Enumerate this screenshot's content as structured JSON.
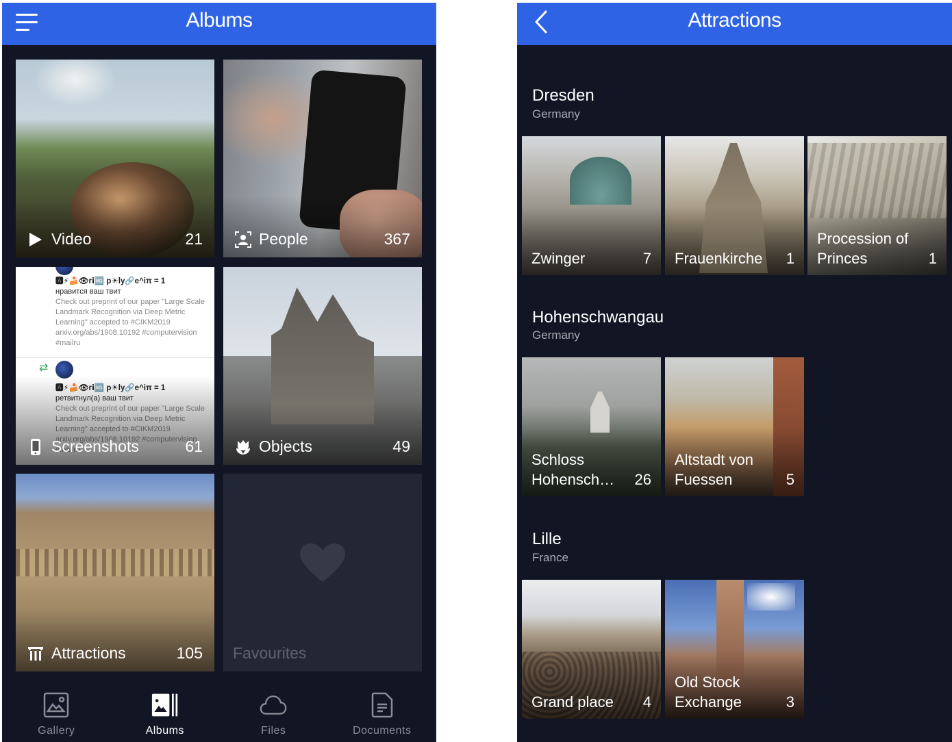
{
  "albums_screen": {
    "header": {
      "title": "Albums",
      "menu_icon": "hamburger-menu-icon"
    },
    "albums": [
      {
        "name": "Video",
        "count": "21",
        "icon": "play-icon"
      },
      {
        "name": "People",
        "count": "367",
        "icon": "face-frame-icon"
      },
      {
        "name": "Screenshots",
        "count": "61",
        "icon": "phone-icon"
      },
      {
        "name": "Objects",
        "count": "49",
        "icon": "flower-icon"
      },
      {
        "name": "Attractions",
        "count": "105",
        "icon": "landmark-icon"
      },
      {
        "name": "Favourites",
        "count": "",
        "icon": "heart-icon"
      }
    ],
    "screenshot_preview": {
      "tweet1": {
        "handle": "🅰⚡🍰👁rⅰ🆖 p☀ly🔗e^iπ = 1",
        "action": "нравится ваш твит",
        "body": "Check out preprint of our paper \"Large Scale Landmark Recognition via Deep Metric Learning\" accepted to #CIKM2019 arxiv.org/abs/1908.10192 #computervision #mailru"
      },
      "tweet2": {
        "handle": "🅰⚡🍰👁rⅰ🆖 p☀ly🔗e^iπ = 1",
        "action": "ретвитнул(а) ваш твит",
        "body": "Check out preprint of our paper \"Large Scale Landmark Recognition via Deep Metric Learning\" accepted to #CIKM2019 arxiv.org/abs/1908.10192 #computervision #mailru"
      }
    },
    "bottom_nav": [
      {
        "label": "Gallery",
        "icon": "gallery-icon",
        "active": false
      },
      {
        "label": "Albums",
        "icon": "albums-icon",
        "active": true
      },
      {
        "label": "Files",
        "icon": "cloud-icon",
        "active": false
      },
      {
        "label": "Documents",
        "icon": "document-icon",
        "active": false
      }
    ]
  },
  "attractions_screen": {
    "header": {
      "title": "Attractions",
      "back_icon": "chevron-left-icon"
    },
    "sections": [
      {
        "city": "Dresden",
        "country": "Germany",
        "items": [
          {
            "name": "Zwinger",
            "count": "7"
          },
          {
            "name": "Frauenkirche",
            "count": "1"
          },
          {
            "name": "Procession of Princes",
            "count": "1"
          }
        ]
      },
      {
        "city": "Hohenschwangau",
        "country": "Germany",
        "items": [
          {
            "name": "Schloss Hohensch…",
            "count": "26"
          },
          {
            "name": "Altstadt von Fuessen",
            "count": "5"
          }
        ]
      },
      {
        "city": "Lille",
        "country": "France",
        "items": [
          {
            "name": "Grand place",
            "count": "4"
          },
          {
            "name": "Old Stock Exchange",
            "count": "3"
          }
        ]
      }
    ]
  },
  "colors": {
    "header_blue": "#2f63e6",
    "background": "#121624",
    "favourites_tile": "#232735",
    "inactive_nav": "#8a8d96",
    "subtitle_gray": "#a7aab3"
  }
}
